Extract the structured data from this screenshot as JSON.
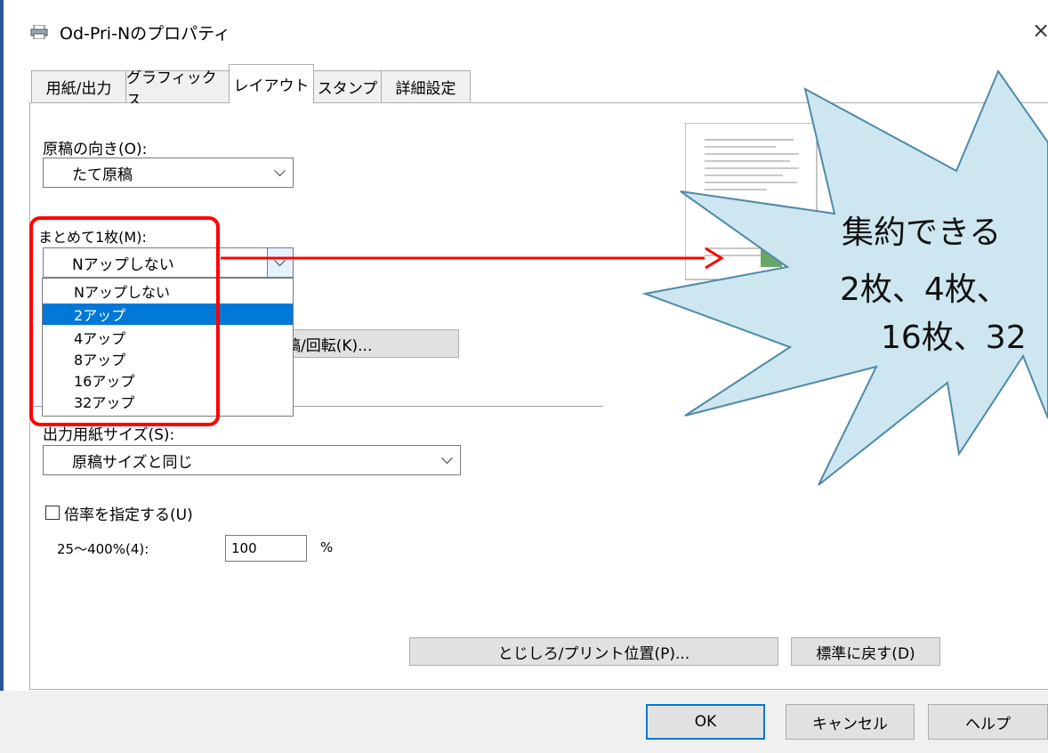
{
  "window": {
    "title": "Od-Pri-Nのプロパティ",
    "close_glyph": "×"
  },
  "tabs": [
    {
      "label": "用紙/出力"
    },
    {
      "label": "グラフィックス"
    },
    {
      "label": "レイアウト",
      "active": true
    },
    {
      "label": "スタンプ"
    },
    {
      "label": "詳細設定"
    }
  ],
  "orientation": {
    "label": "原稿の向き(O):",
    "value": "たて原稿"
  },
  "nup": {
    "label": "まとめて1枚(M):",
    "value": "Nアップしない",
    "options": [
      "Nアップしない",
      "2アップ",
      "4アップ",
      "8アップ",
      "16アップ",
      "32アップ"
    ],
    "highlighted": "2アップ"
  },
  "hidden_button_label": "稿/回転(K)...",
  "output_size": {
    "label": "出力用紙サイズ(S):",
    "value": "原稿サイズと同じ"
  },
  "scale": {
    "checkbox_label": "倍率を指定する(U)",
    "range_label": "25〜400%(4):",
    "value": "100",
    "unit": "%"
  },
  "buttons": {
    "binding": "とじしろ/プリント位置(P)...",
    "reset": "標準に戻す(D)",
    "ok": "OK",
    "cancel": "キャンセル",
    "help": "ヘルプ"
  },
  "callout": {
    "line1": "集約できる",
    "line2": "2枚、4枚、",
    "line3": "16枚、32"
  },
  "colors": {
    "accent": "#0078d7",
    "highlight_box": "#ff0000",
    "callout_fill": "#cde6f0",
    "callout_stroke": "#4f8aa8"
  }
}
